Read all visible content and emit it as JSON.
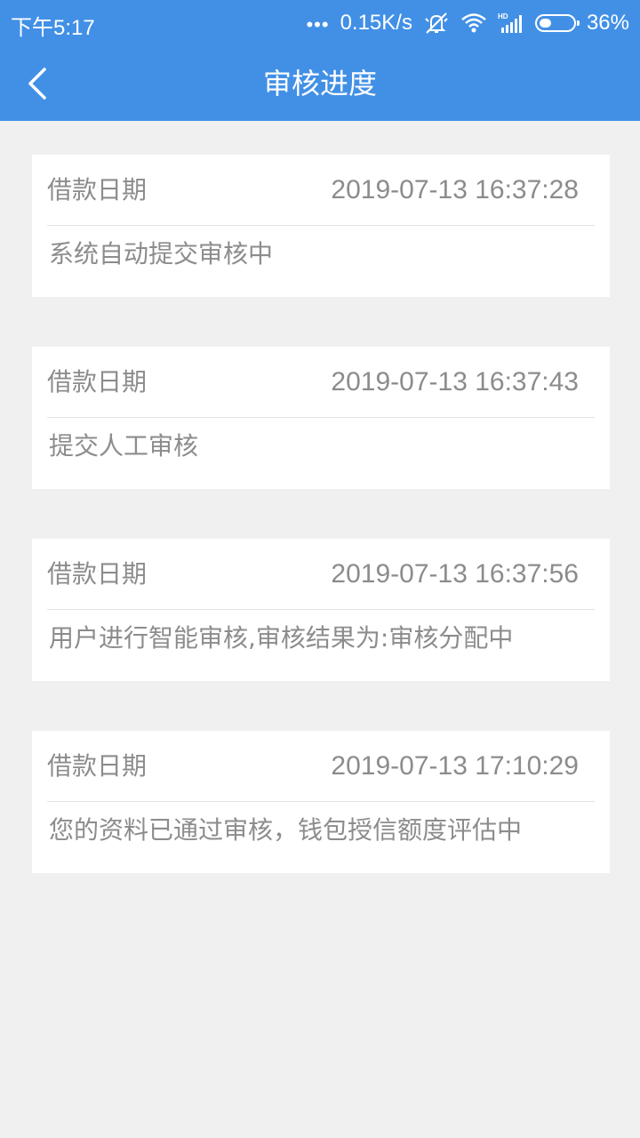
{
  "status_bar": {
    "time": "下午5:17",
    "dots": "•••",
    "net_speed": "0.15K/s",
    "battery_percent": "36%",
    "battery_level": 0.36,
    "icons": [
      "mute-vibrate-icon",
      "wifi-icon",
      "hd-signal-icon",
      "battery-icon"
    ]
  },
  "header": {
    "title": "审核进度",
    "back_icon": "chevron-left-icon"
  },
  "records": [
    {
      "label": "借款日期",
      "date": "2019-07-13 16:37:28",
      "description": "系统自动提交审核中"
    },
    {
      "label": "借款日期",
      "date": "2019-07-13 16:37:43",
      "description": "提交人工审核"
    },
    {
      "label": "借款日期",
      "date": "2019-07-13 16:37:56",
      "description": "用户进行智能审核,审核结果为:审核分配中"
    },
    {
      "label": "借款日期",
      "date": "2019-07-13 17:10:29",
      "description": "您的资料已通过审核，钱包授信额度评估中"
    }
  ],
  "colors": {
    "primary": "#4290e6",
    "background": "#f0f0f0",
    "card": "#ffffff",
    "text": "#8c8c8c",
    "divider": "#e2e2e2"
  }
}
